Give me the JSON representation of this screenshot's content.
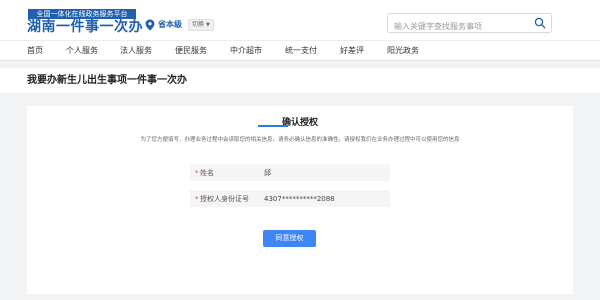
{
  "header": {
    "logo_small": "全国一体化在线政务服务平台",
    "logo_big": "湖南一件事一次办",
    "location": "省本级",
    "switch_label": "切换",
    "search_placeholder": "输入关键字查找服务事项"
  },
  "nav": {
    "items": [
      {
        "label": "首页"
      },
      {
        "label": "个人服务"
      },
      {
        "label": "法人服务"
      },
      {
        "label": "便民服务"
      },
      {
        "label": "中介超市"
      },
      {
        "label": "统一支付"
      },
      {
        "label": "好差评"
      },
      {
        "label": "阳光政务"
      }
    ]
  },
  "page": {
    "title": "我要办新生儿出生事项一件事一次办"
  },
  "auth": {
    "title": "确认授权",
    "notice": "为了您方便填写、办理业务过程中会读取您的相关信息，请务必确认信息的准确性。请授权我们在业务办理过程中可以使用您的信息",
    "fields": [
      {
        "required": "*",
        "label": "姓名",
        "value": "邱"
      },
      {
        "required": "*",
        "label": "授权人身份证号",
        "value": "4307**********2088"
      }
    ],
    "agree_button": "同意授权"
  },
  "colors": {
    "brand_blue": "#1f5fb0",
    "button_blue": "#3f86f5",
    "required_red": "#e54545"
  }
}
